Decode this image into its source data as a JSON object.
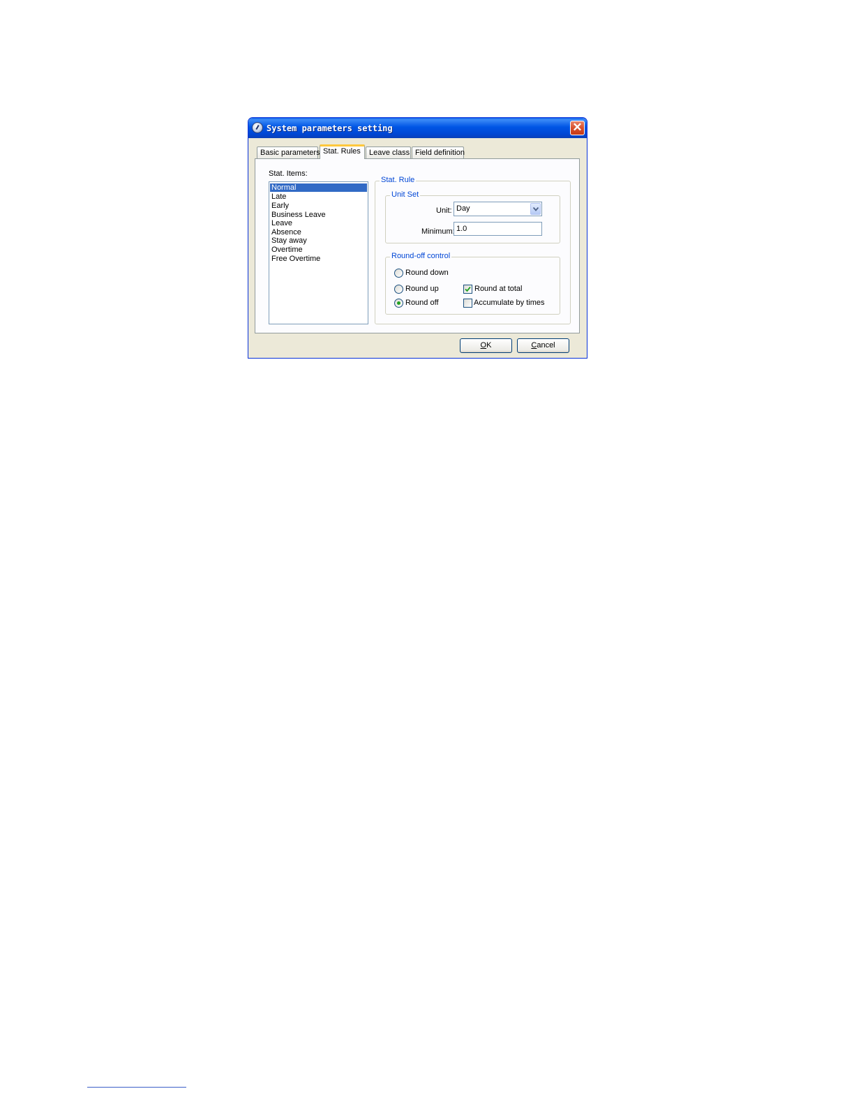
{
  "window": {
    "title": "System parameters setting",
    "close_symbol": "✕",
    "icon": "clock-app-icon"
  },
  "tabs": [
    {
      "label": "Basic parameters",
      "active": false
    },
    {
      "label": "Stat. Rules",
      "active": true
    },
    {
      "label": "Leave class",
      "active": false
    },
    {
      "label": "Field definition",
      "active": false
    }
  ],
  "stat_items": {
    "label": "Stat. Items:",
    "items": [
      "Normal",
      "Late",
      "Early",
      "Business Leave",
      "Leave",
      "Absence",
      "Stay away",
      "Overtime",
      "Free Overtime"
    ],
    "selected": "Normal"
  },
  "stat_rule": {
    "legend": "Stat. Rule",
    "unit_set": {
      "legend": "Unit Set",
      "unit_label": "Unit:",
      "unit_value": "Day",
      "minimum_label": "Minimum:",
      "minimum_value": "1.0"
    },
    "round_off": {
      "legend": "Round-off control",
      "round_down": "Round down",
      "round_up": "Round up",
      "round_off": "Round off",
      "selected": "Round off",
      "round_at_total": "Round at total",
      "round_at_total_checked": true,
      "accumulate_by_times": "Accumulate by times",
      "accumulate_by_times_checked": false
    }
  },
  "buttons": {
    "ok_mnemonic": "O",
    "ok_rest": "K",
    "cancel_mnemonic": "C",
    "cancel_rest": "ancel"
  },
  "colors": {
    "titlebar": "#0055e5",
    "selection": "#316ac5",
    "group_legend": "#0046d5",
    "active_tab_accent": "#ffc83c"
  }
}
